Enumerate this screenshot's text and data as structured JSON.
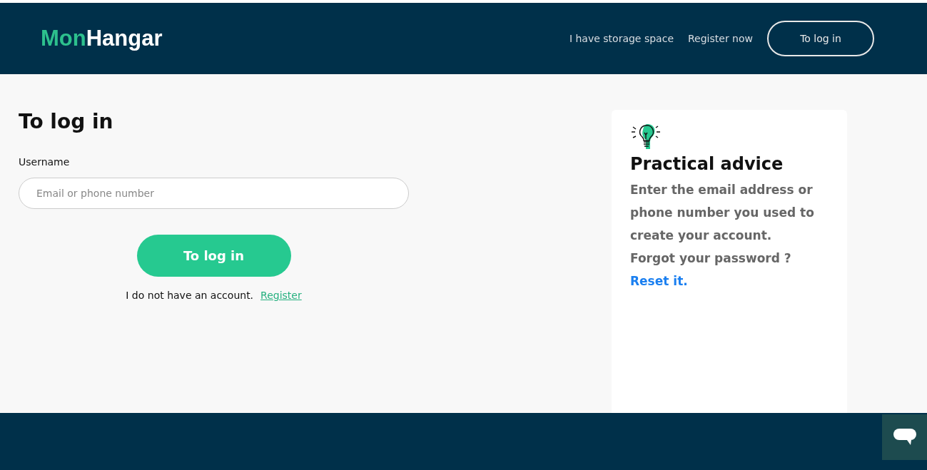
{
  "header": {
    "logo": {
      "accent": "Mon",
      "rest": "Hangar"
    },
    "nav_links": [
      "I have storage space",
      "Register now"
    ],
    "login_button": "To log in"
  },
  "login": {
    "title": "To log in",
    "username_label": "Username",
    "username_placeholder": "Email or phone number",
    "submit": "To log in",
    "no_account_text": "I do not have an account.",
    "register_link": "Register"
  },
  "advice": {
    "title": "Practical advice",
    "body": "Enter the email address or phone number you used to create your account.",
    "forgot": "Forgot your password ?",
    "reset_link": "Reset it."
  }
}
